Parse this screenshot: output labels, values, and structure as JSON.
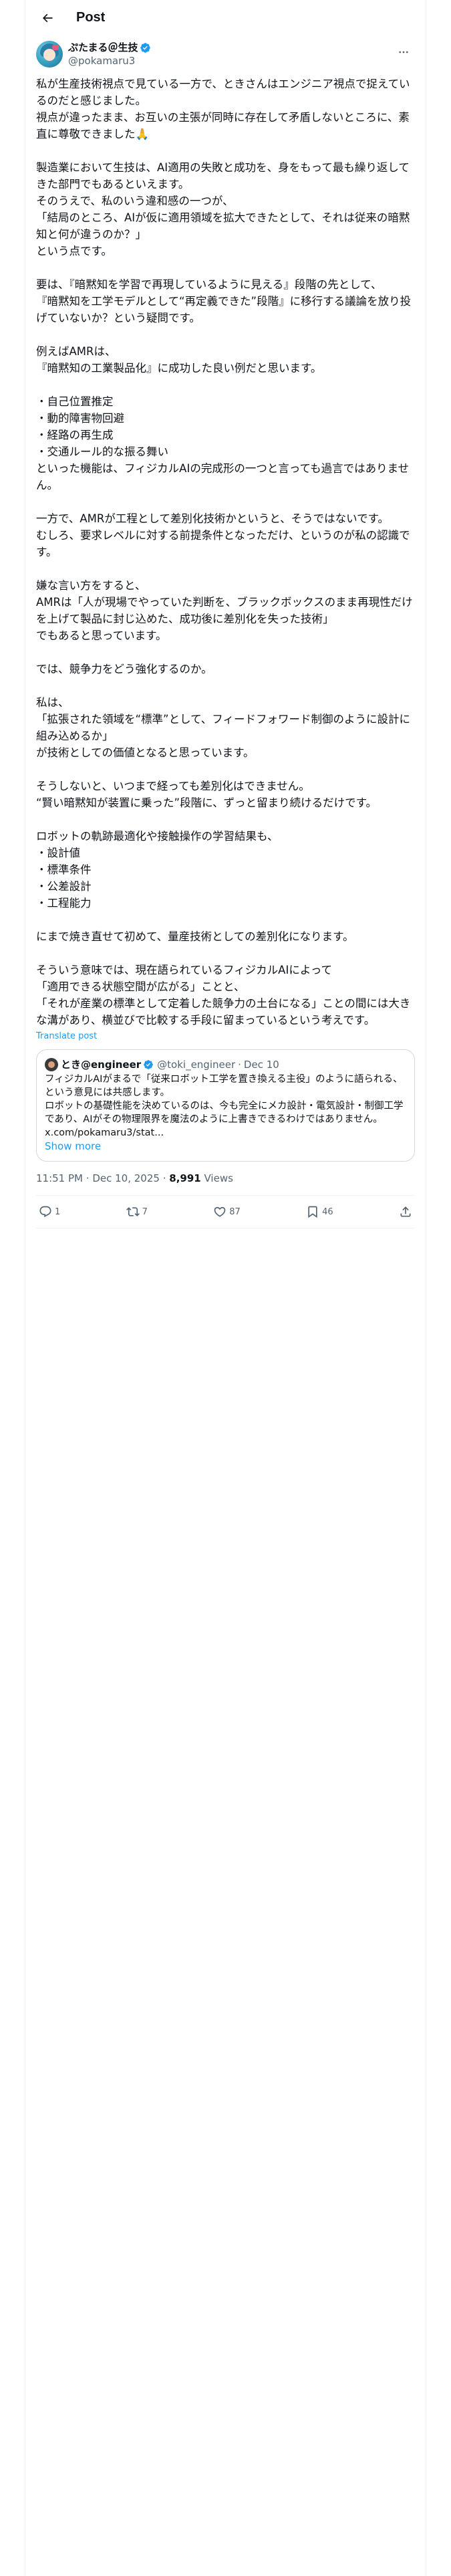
{
  "header": {
    "title": "Post",
    "back_icon": "arrow-left-icon"
  },
  "author": {
    "display_name": "ぷたまる＠生技",
    "handle": "@pokamaru3",
    "verified": true,
    "verified_color": "#1d9bf0"
  },
  "post": {
    "text": "私が生産技術視点で見ている一方で、ときさんはエンジニア視点で捉えているのだと感じました。\n視点が違ったまま、お互いの主張が同時に存在して矛盾しないところに、素直に尊敬できました🙏\n\n製造業において生技は、AI適用の失敗と成功を、身をもって最も繰り返してきた部門でもあるといえます。\nそのうえで、私のいう違和感の一つが、\n「結局のところ、AIが仮に適用領域を拡大できたとして、それは従来の暗黙知と何が違うのか？」\nという点です。\n\n要は、『暗黙知を学習で再現しているように見える』段階の先として、\n『暗黙知を工学モデルとして“再定義できた”段階』に移行する議論を放り投げていないか？という疑問です。\n\n例えばAMRは、\n『暗黙知の工業製品化』に成功した良い例だと思います。\n\n・自己位置推定\n・動的障害物回避\n・経路の再生成\n・交通ルール的な振る舞い\nといった機能は、フィジカルAIの完成形の一つと言っても過言ではありません。\n\n一方で、AMRが工程として差別化技術かというと、そうではないです。\nむしろ、要求レベルに対する前提条件となっただけ、というのが私の認識です。\n\n嫌な言い方をすると、\nAMRは「人が現場でやっていた判断を、ブラックボックスのまま再現性だけを上げて製品に封じ込めた、成功後に差別化を失った技術」\nでもあると思っています。\n\nでは、競争力をどう強化するのか。\n\n私は、\n「拡張された領域を“標準”として、フィードフォワード制御のように設計に組み込めるか」\nが技術としての価値となると思っています。\n\nそうしないと、いつまで経っても差別化はできません。\n“賢い暗黙知が装置に乗った”段階に、ずっと留まり続けるだけです。\n\nロボットの軌跡最適化や接触操作の学習結果も、\n・設計値\n・標準条件\n・公差設計\n・工程能力\n\nにまで焼き直せて初めて、量産技術としての差別化になります。\n\nそういう意味では、現在語られているフィジカルAIによって\n「適用できる状態空間が広がる」ことと、\n「それが産業の標準として定着した競争力の土台になる」ことの間には大きな溝があり、横並びで比較する手段に留まっているという考えです。",
    "translate_label": "Translate post"
  },
  "quote": {
    "display_name": "とき@engineer",
    "verified": true,
    "handle": "@toki_engineer",
    "separator": "·",
    "date": "Dec 10",
    "text": "フィジカルAIがまるで「従来ロボット工学を置き換える主役」のように語られる、という意見には共感します。\nロボットの基礎性能を決めているのは、今も完全にメカ設計・電気設計・制御工学であり、AIがその物理限界を魔法のように上書きできるわけではありません。\nx.com/pokamaru3/stat...",
    "show_more_label": "Show more"
  },
  "meta": {
    "time": "11:51 PM",
    "separator": "·",
    "date": "Dec 10, 2025",
    "separator2": "·",
    "views_count": "8,991",
    "views_label": "Views"
  },
  "actions": {
    "replies": "1",
    "reposts": "7",
    "likes": "87",
    "bookmarks": "46"
  },
  "icons": {
    "reply": "reply-icon",
    "repost": "repost-icon",
    "like": "heart-icon",
    "bookmark": "bookmark-icon",
    "share": "share-icon",
    "more": "more-dots-icon"
  },
  "colors": {
    "accent": "#1d9bf0",
    "text_primary": "#0f1419",
    "text_secondary": "#536471",
    "border": "#eff3f4"
  }
}
